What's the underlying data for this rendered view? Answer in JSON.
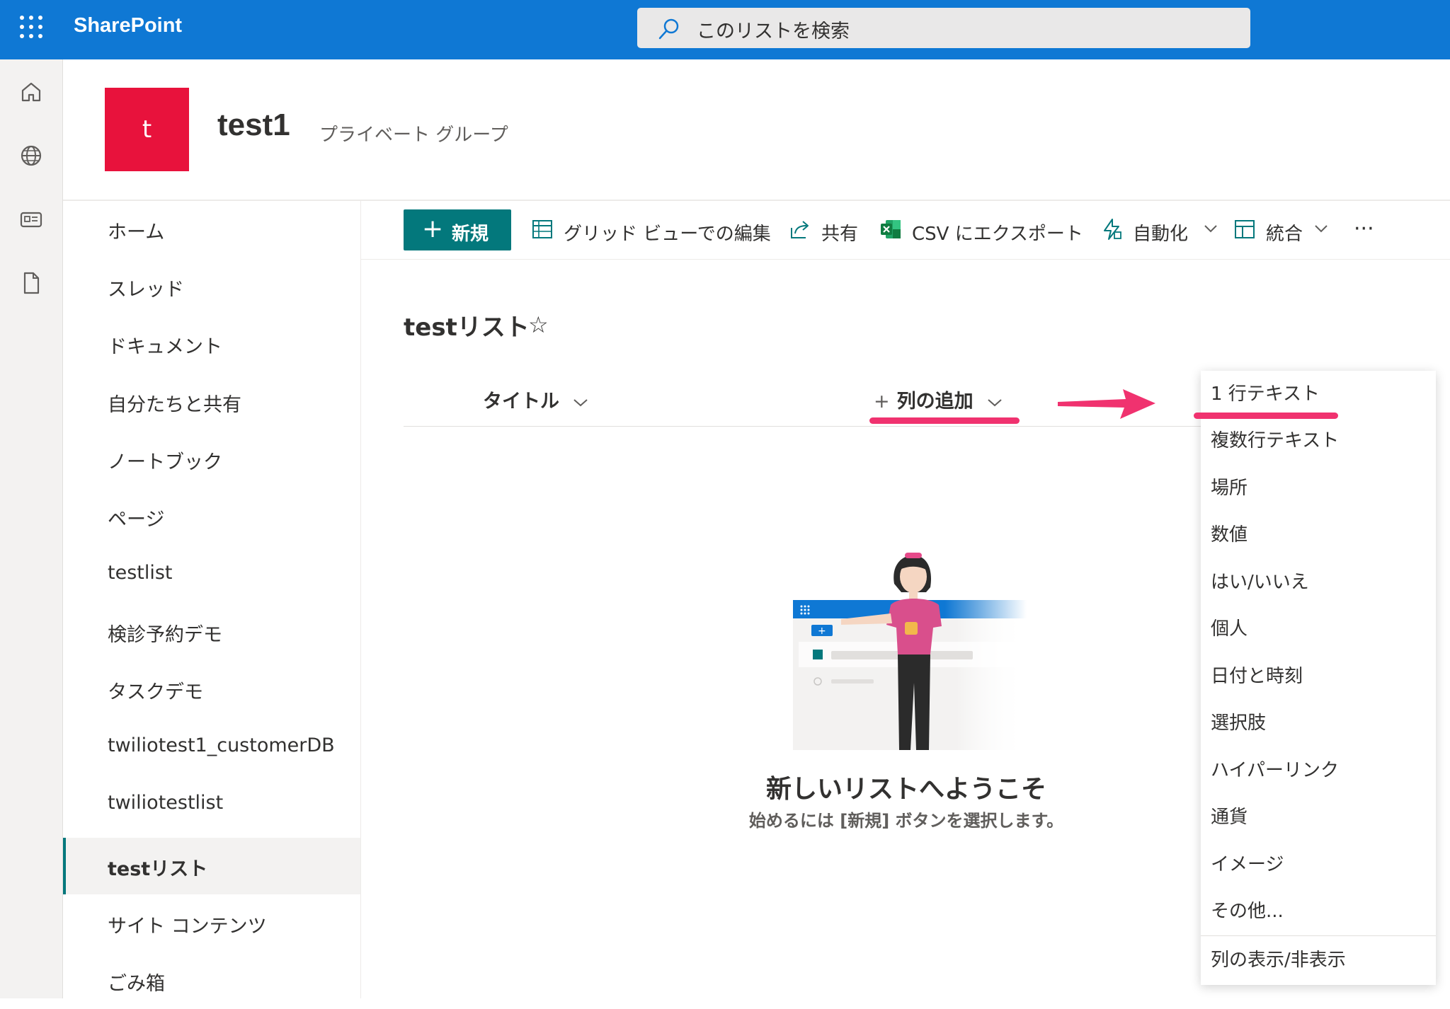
{
  "app": {
    "name": "SharePoint"
  },
  "search": {
    "placeholder": "このリストを検索"
  },
  "site": {
    "logo_letter": "t",
    "title": "test1",
    "subtitle": "プライベート グループ"
  },
  "nav": {
    "items": [
      {
        "label": "ホーム"
      },
      {
        "label": "スレッド"
      },
      {
        "label": "ドキュメント"
      },
      {
        "label": "自分たちと共有"
      },
      {
        "label": "ノートブック"
      },
      {
        "label": "ページ"
      },
      {
        "label": "testlist"
      },
      {
        "label": "検診予約デモ"
      },
      {
        "label": "タスクデモ"
      },
      {
        "label": "twiliotest1_customerDB"
      },
      {
        "label": "twiliotestlist"
      },
      {
        "label": "testリスト"
      },
      {
        "label": "サイト コンテンツ"
      },
      {
        "label": "ごみ箱"
      }
    ]
  },
  "commandbar": {
    "new_label": "新規",
    "grid_edit_label": "グリッド ビューでの編集",
    "share_label": "共有",
    "export_label": "CSV にエクスポート",
    "automate_label": "自動化",
    "integrate_label": "統合",
    "more_label": "···"
  },
  "list": {
    "title": "testリスト",
    "star": "☆",
    "col_title": "タイトル",
    "add_column_label": "列の追加",
    "welcome": "新しいリストへようこそ",
    "welcome_sub": "始めるには [新規] ボタンを選択します。"
  },
  "menu": {
    "items": [
      {
        "label": "1 行テキスト"
      },
      {
        "label": "複数行テキスト"
      },
      {
        "label": "場所"
      },
      {
        "label": "数値"
      },
      {
        "label": "はい/いいえ"
      },
      {
        "label": "個人"
      },
      {
        "label": "日付と時刻"
      },
      {
        "label": "選択肢"
      },
      {
        "label": "ハイパーリンク"
      },
      {
        "label": "通貨"
      },
      {
        "label": "イメージ"
      },
      {
        "label": "その他..."
      }
    ],
    "footer_label": "列の表示/非表示"
  },
  "colors": {
    "topbar": "#0f78d4",
    "accent": "#03787c",
    "logo": "#e8123c",
    "annotation": "#f0326f"
  }
}
